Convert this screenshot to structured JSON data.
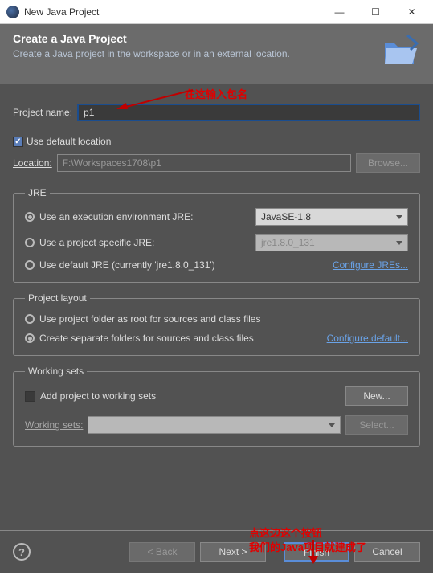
{
  "titlebar": {
    "title": "New Java Project"
  },
  "header": {
    "title": "Create a Java Project",
    "desc": "Create a Java project in the workspace or in an external location."
  },
  "annotations": {
    "top": "在这输入包名",
    "bottom_line1": "点这边这个按钮",
    "bottom_line2": "我们的Java项目就建成了"
  },
  "projectName": {
    "label": "Project name:",
    "value": "p1"
  },
  "location": {
    "useDefault": "Use default location",
    "label": "Location:",
    "value": "F:\\Workspaces1708\\p1",
    "browse": "Browse..."
  },
  "jre": {
    "legend": "JRE",
    "opt1": "Use an execution environment JRE:",
    "opt1val": "JavaSE-1.8",
    "opt2": "Use a project specific JRE:",
    "opt2val": "jre1.8.0_131",
    "opt3": "Use default JRE (currently 'jre1.8.0_131')",
    "configure": "Configure JREs..."
  },
  "layout": {
    "legend": "Project layout",
    "opt1": "Use project folder as root for sources and class files",
    "opt2": "Create separate folders for sources and class files",
    "configure": "Configure default..."
  },
  "ws": {
    "legend": "Working sets",
    "add": "Add project to working sets",
    "new": "New...",
    "label": "Working sets:",
    "select": "Select..."
  },
  "footer": {
    "back": "< Back",
    "next": "Next >",
    "finish": "Finish",
    "cancel": "Cancel"
  }
}
